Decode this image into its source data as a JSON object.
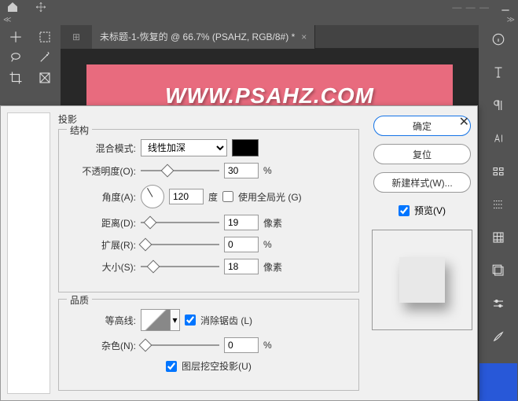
{
  "tab": {
    "title": "未标题-1-恢复的 @ 66.7% (PSAHZ, RGB/8#) *"
  },
  "banner": {
    "text": "WWW.PSAHZ.COM"
  },
  "dialog": {
    "title": "投影",
    "structure_label": "结构",
    "quality_label": "品质",
    "blend_mode_label": "混合模式:",
    "blend_mode_value": "线性加深",
    "opacity_label": "不透明度(O):",
    "opacity_value": "30",
    "opacity_unit": "%",
    "angle_label": "角度(A):",
    "angle_value": "120",
    "angle_unit": "度",
    "global_light_label": "使用全局光 (G)",
    "distance_label": "距离(D):",
    "distance_value": "19",
    "distance_unit": "像素",
    "spread_label": "扩展(R):",
    "spread_value": "0",
    "spread_unit": "%",
    "size_label": "大小(S):",
    "size_value": "18",
    "size_unit": "像素",
    "contour_label": "等高线:",
    "antialias_label": "消除锯齿 (L)",
    "noise_label": "杂色(N):",
    "noise_value": "0",
    "noise_unit": "%",
    "knockout_label": "图层挖空投影(U)",
    "ok": "确定",
    "reset": "复位",
    "new_style": "新建样式(W)...",
    "preview_label": "预览(V)"
  }
}
